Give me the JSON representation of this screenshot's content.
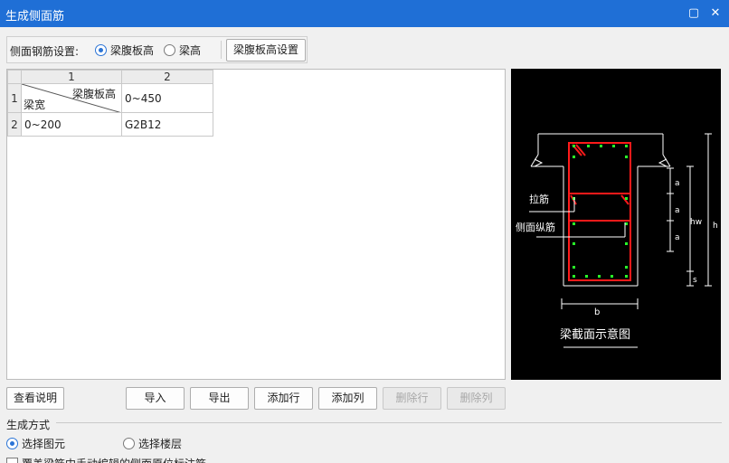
{
  "window": {
    "title": "生成侧面筋",
    "min_glyph": "▢",
    "close_glyph": "✕"
  },
  "settings": {
    "label": "侧面钢筋设置:",
    "options": [
      {
        "label": "梁腹板高",
        "checked": true
      },
      {
        "label": "梁高",
        "checked": false
      }
    ],
    "button": "梁腹板高设置"
  },
  "table": {
    "col_headers": [
      "1",
      "2"
    ],
    "row_headers": [
      "1",
      "2"
    ],
    "corner_top": "梁腹板高",
    "corner_bottom": "梁宽",
    "rows": [
      {
        "c1": "",
        "c2": "0~450"
      },
      {
        "c1": "0~200",
        "c2": "G2B12"
      }
    ]
  },
  "diagram": {
    "caption": "梁截面示意图",
    "label_tie": "拉筋",
    "label_side": "侧面纵筋",
    "dim_a": "a",
    "dim_hw": "hw",
    "dim_h": "h",
    "dim_s": "s",
    "dim_b": "b"
  },
  "buttons": {
    "help": "查看说明",
    "import": "导入",
    "export": "导出",
    "add_row": "添加行",
    "add_col": "添加列",
    "del_row": "删除行",
    "del_col": "删除列"
  },
  "generate": {
    "section_title": "生成方式",
    "options": [
      {
        "label": "选择图元",
        "checked": true
      },
      {
        "label": "选择楼层",
        "checked": false
      }
    ],
    "checkbox_label": "覆盖梁筋中手动编辑的侧面原位标注筋"
  }
}
